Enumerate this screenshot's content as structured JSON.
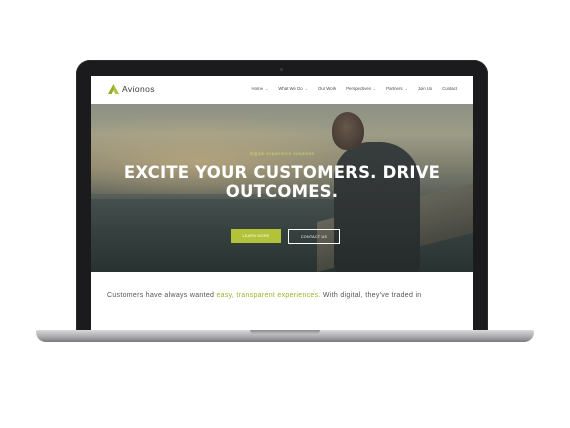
{
  "brand": {
    "name": "Avionos"
  },
  "nav": {
    "items": [
      {
        "label": "Home",
        "dropdown": true
      },
      {
        "label": "What We Do",
        "dropdown": true
      },
      {
        "label": "Our Work",
        "dropdown": false
      },
      {
        "label": "Perspectives",
        "dropdown": true
      },
      {
        "label": "Partners",
        "dropdown": true
      },
      {
        "label": "Join Us",
        "dropdown": false
      },
      {
        "label": "Contact",
        "dropdown": false
      }
    ]
  },
  "hero": {
    "eyebrow": "Digital experience solutions",
    "headline_line1": "EXCITE YOUR CUSTOMERS. DRIVE",
    "headline_line2": "OUTCOMES.",
    "primary_cta": "LEARN MORE",
    "secondary_cta": "CONTACT US"
  },
  "intro": {
    "text_before": "Customers have always wanted ",
    "highlight": "easy, transparent experiences.",
    "text_after": " With digital, they've traded in"
  },
  "colors": {
    "accent": "#b3c23b",
    "laptop_bezel": "#1b1b1d",
    "headline": "#ffffff"
  },
  "icons": {
    "chevron": "chevron-down-icon",
    "logo": "avionos-triangle-logo"
  }
}
